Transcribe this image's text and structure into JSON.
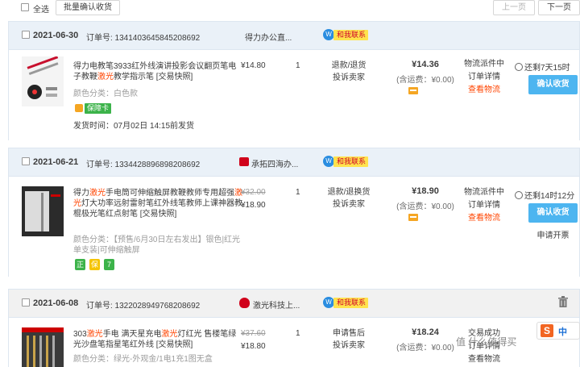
{
  "toolbar": {
    "select_all_label": "全选",
    "batch_confirm_label": "批量确认收货",
    "prev_page_label": "上一页",
    "next_page_label": "下一页"
  },
  "contact_label": "和我联系",
  "ww_icon_text": "W",
  "orders": [
    {
      "date": "2021-06-30",
      "order_no": "订单号: 1341403645845208692",
      "shop": "得力办公直...",
      "title_parts": [
        "得力电教笔3933红外线演讲投影会议翻页笔电子教鞭",
        "激光",
        "教学指示笔 [交易快照]"
      ],
      "variant": "颜色分类：白色款",
      "badge_label": "保障卡",
      "ship_time": "发货时间：07月02日 14:15前发货",
      "price": "¥14.80",
      "qty": "1",
      "ops": [
        "退款/退货",
        "投诉卖家"
      ],
      "total": "¥14.36",
      "shipping_fee": "(含运费：¥0.00)",
      "status": [
        "物流派件中",
        "订单详情",
        "查看物流"
      ],
      "timer": "还剩7天15时",
      "confirm_label": "确认收货"
    },
    {
      "date": "2021-06-21",
      "order_no": "订单号: 1334428896898208692",
      "shop": "承拓四海办...",
      "title_parts": [
        "得力",
        "激光",
        "手电筒可伸缩触屏教鞭教师专用超强",
        "激光",
        "灯大功率远射雷射笔红外线笔教师上课神器教棍极光笔红点射笔 [交易快照]"
      ],
      "variant": "颜色分类：【预售/6月30日左右发出】银色|红光 单支装|可伸缩触屏",
      "original_price": "¥32.00",
      "price": "¥18.90",
      "qty": "1",
      "ops": [
        "退款/退换货",
        "投诉卖家"
      ],
      "total": "¥18.90",
      "shipping_fee": "(含运费：¥0.00)",
      "status": [
        "物流派件中",
        "订单详情",
        "查看物流"
      ],
      "timer": "还剩14时12分",
      "confirm_label": "确认收货",
      "extra_action": "申请开票",
      "service_badges": [
        "正",
        "保",
        "7"
      ]
    },
    {
      "date": "2021-06-08",
      "order_no": "订单号: 1322028949768208692",
      "shop": "激光科技上...",
      "title_parts": [
        "303",
        "激光",
        "手电 满天星充电",
        "激光",
        "灯红光 售楼笔绿光沙盘笔指星笔红外线 [交易快照]"
      ],
      "variant": "颜色分类：绿光-外观金/1电1充1图无盒",
      "original_price": "¥37.60",
      "price": "¥18.80",
      "qty": "1",
      "ops": [
        "申请售后",
        "投诉卖家"
      ],
      "total": "¥18.24",
      "shipping_fee": "(含运费：¥0.00)",
      "status": [
        "交易成功",
        "订单详情",
        "查看物流"
      ]
    }
  ],
  "overlay": {
    "ime_s": "S",
    "ime_lang": "中",
    "watermark": "值 什么值得买"
  },
  "colors": {
    "accent_blue": "#4db5f0",
    "highlight_red": "#ff4400",
    "header_blue": "#eaf1f8",
    "contact_yellow": "#ffe34d"
  }
}
